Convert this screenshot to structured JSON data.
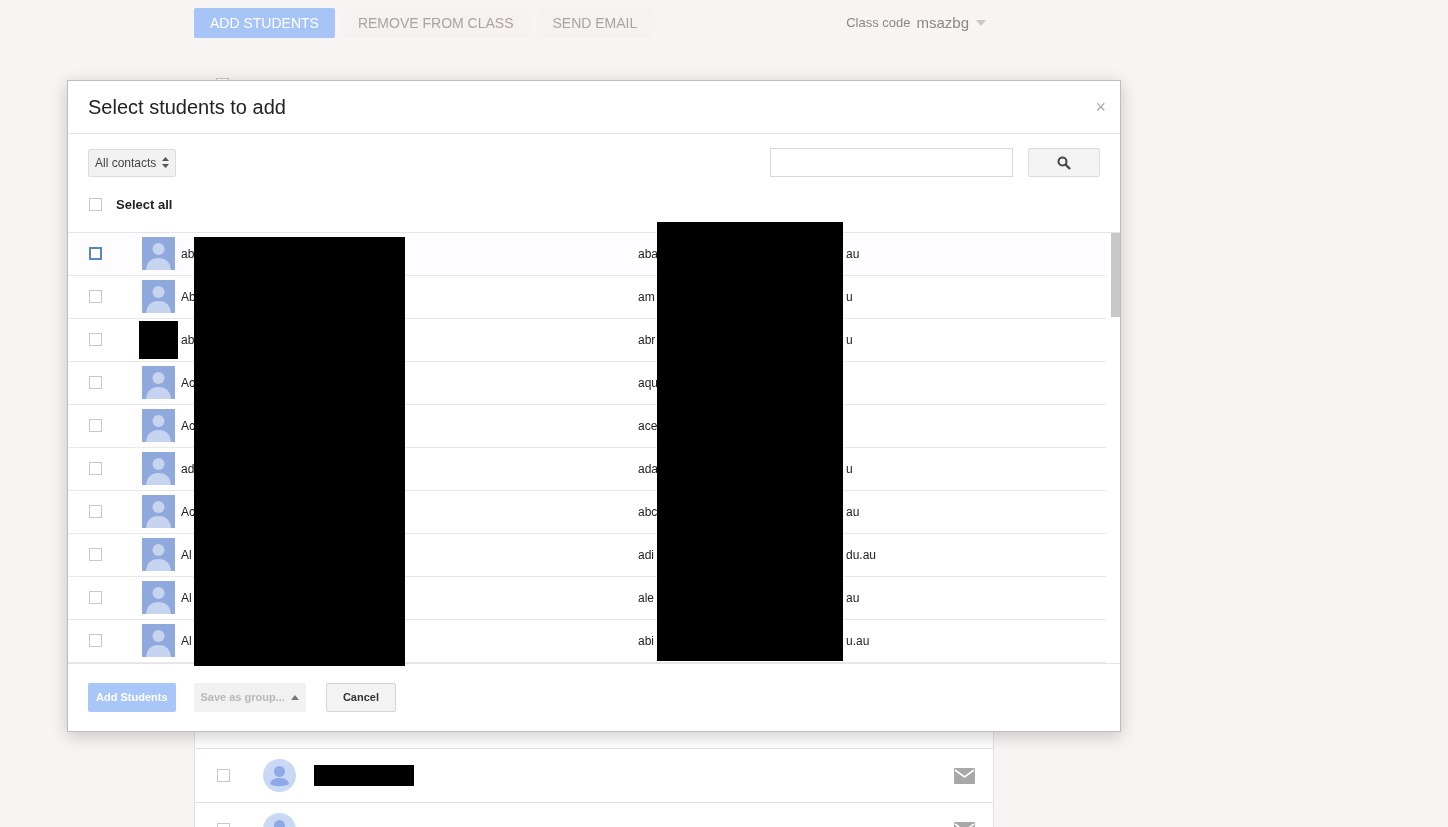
{
  "toolbar": {
    "buttons": [
      {
        "label": "ADD STUDENTS",
        "disabled": false
      },
      {
        "label": "REMOVE FROM CLASS",
        "disabled": true
      },
      {
        "label": "SEND EMAIL",
        "disabled": true
      }
    ],
    "class_code_label": "Class code",
    "class_code": "msazbg"
  },
  "background_list": {
    "header_checked": false,
    "rows": [
      {
        "checked": false,
        "name_redacted": true
      },
      {
        "checked": false,
        "name_redacted": false
      }
    ]
  },
  "dialog": {
    "title": "Select students to add",
    "close": "×",
    "filter": "All contacts",
    "select_all": {
      "label": "Select all",
      "checked": false
    },
    "rows": [
      {
        "name": "ab",
        "email_start": "aba",
        "email_end": "au",
        "checked": false,
        "focused": true,
        "avatar_redacted": false
      },
      {
        "name": "Ab",
        "email_start": "am",
        "email_end": "u",
        "checked": false,
        "focused": false,
        "avatar_redacted": false
      },
      {
        "name": "ab",
        "email_start": "abr",
        "email_end": "u",
        "checked": false,
        "focused": false,
        "avatar_redacted": true
      },
      {
        "name": "Ac",
        "email_start": "aqu",
        "checked": false,
        "focused": false,
        "avatar_redacted": false
      },
      {
        "name": "Ac",
        "email_start": "ace",
        "checked": false,
        "focused": false,
        "avatar_redacted": false
      },
      {
        "name": "ad",
        "email_start": "ada",
        "email_end": "u",
        "checked": false,
        "focused": false,
        "avatar_redacted": false
      },
      {
        "name": "Ac",
        "email_start": "abc",
        "email_end": "au",
        "checked": false,
        "focused": false,
        "avatar_redacted": false
      },
      {
        "name": "Al",
        "email_start": "adi",
        "email_end": "du.au",
        "checked": false,
        "focused": false,
        "avatar_redacted": false
      },
      {
        "name": "Al",
        "email_start": "ale",
        "email_end": "au",
        "checked": false,
        "focused": false,
        "avatar_redacted": false
      },
      {
        "name": "Al",
        "email_start": "abi",
        "email_end": "u.au",
        "checked": false,
        "focused": false,
        "avatar_redacted": false
      }
    ],
    "footer": {
      "add": {
        "label": "Add Students",
        "disabled": true
      },
      "save_group": {
        "label": "Save as group...",
        "disabled": true
      },
      "cancel": {
        "label": "Cancel"
      }
    }
  }
}
